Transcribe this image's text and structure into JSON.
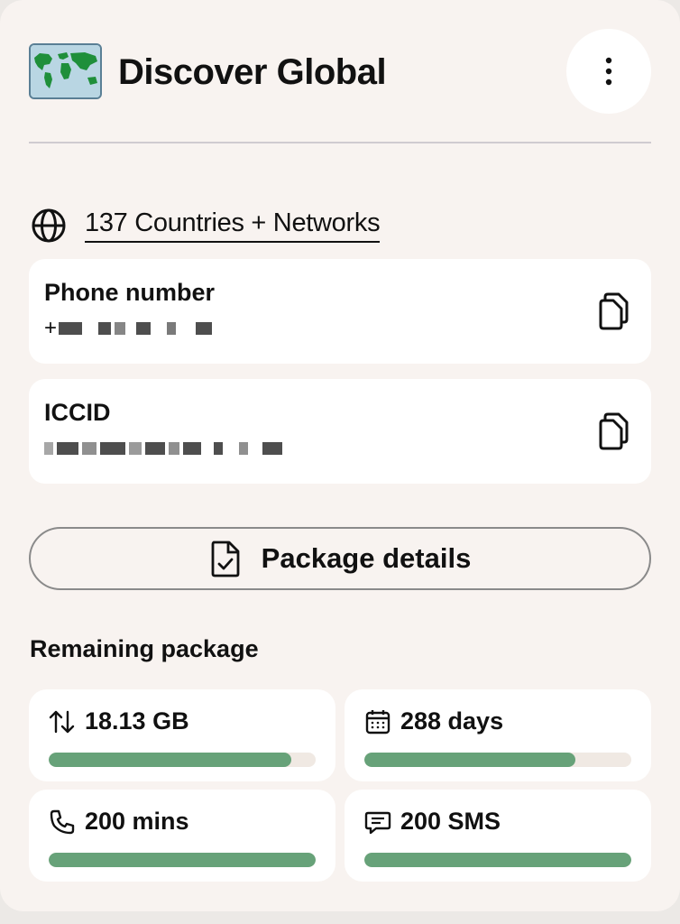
{
  "header": {
    "title": "Discover Global",
    "logo_icon": "world-map-flag-icon",
    "menu_icon": "more-vertical-icon"
  },
  "coverage": {
    "icon": "globe-icon",
    "link_text": "137 Countries + Networks"
  },
  "phone": {
    "label": "Phone number",
    "value_prefix": "+",
    "copy_icon": "copy-icon"
  },
  "iccid": {
    "label": "ICCID",
    "copy_icon": "copy-icon"
  },
  "package_button": {
    "label": "Package details",
    "icon": "document-check-icon"
  },
  "remaining": {
    "title": "Remaining package",
    "items": [
      {
        "value": "18.13 GB",
        "icon": "data-transfer-icon",
        "fraction": 0.91
      },
      {
        "value": "288 days",
        "icon": "calendar-icon",
        "fraction": 0.79
      },
      {
        "value": "200 mins",
        "icon": "phone-icon",
        "fraction": 1.0
      },
      {
        "value": "200 SMS",
        "icon": "message-icon",
        "fraction": 1.0
      }
    ]
  },
  "colors": {
    "accent_green": "#67a279",
    "card_bg": "#f8f3f0",
    "track": "#f0e9e3"
  }
}
